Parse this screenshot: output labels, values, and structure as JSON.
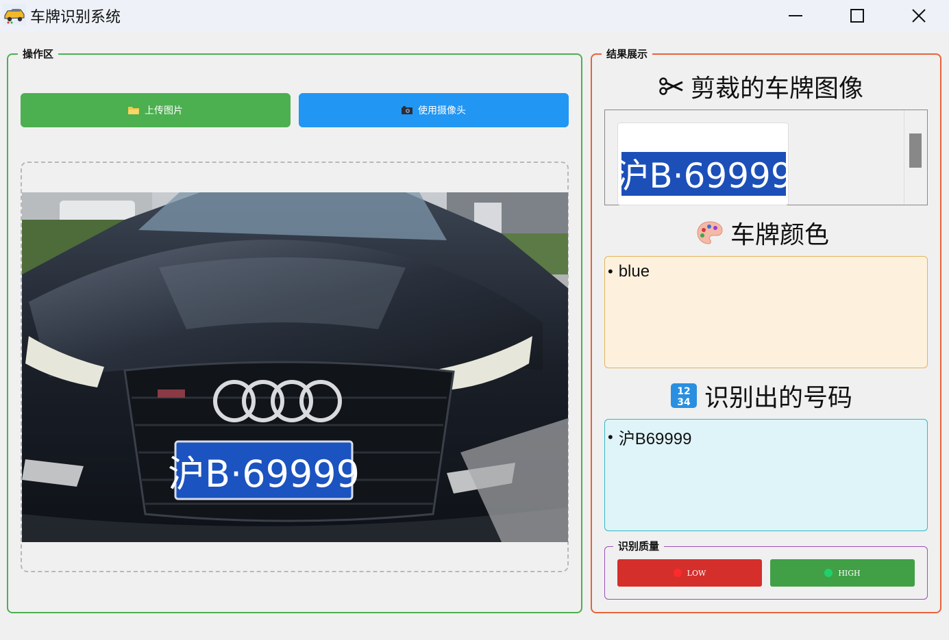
{
  "window": {
    "title": "车牌识别系统",
    "app_icon": "car-icon",
    "controls": [
      "minimize-icon",
      "maximize-icon",
      "close-icon"
    ]
  },
  "operation_area": {
    "legend": "操作区",
    "upload_button": {
      "icon": "folder-icon",
      "label": "上传图片",
      "color": "#4caf50"
    },
    "camera_button": {
      "icon": "camera-icon",
      "label": "使用摄像头",
      "color": "#2196f3"
    },
    "image": {
      "plate_text": "沪B·69999"
    }
  },
  "results": {
    "legend": "结果展示",
    "crop": {
      "icon": "scissors-icon",
      "title": "剪裁的车牌图像",
      "plate_text": "沪B·69999"
    },
    "color": {
      "icon": "palette-icon",
      "title": "车牌颜色",
      "items": [
        "blue"
      ]
    },
    "number": {
      "icon": "numbers-icon",
      "title": "识别出的号码",
      "items": [
        "沪B69999"
      ]
    },
    "quality": {
      "legend": "识别质量",
      "low_label": "LOW",
      "high_label": "HIGH",
      "low_color": "#d42f2b",
      "high_color": "#41a046"
    }
  }
}
